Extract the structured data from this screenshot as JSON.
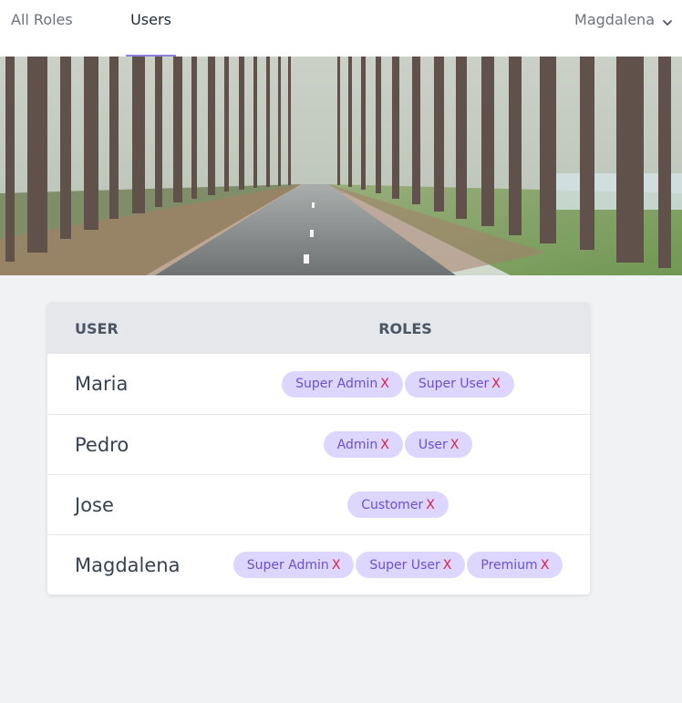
{
  "nav": {
    "tabs": [
      {
        "label": "All Roles",
        "active": false
      },
      {
        "label": "Users",
        "active": true
      }
    ],
    "current_user": "Magdalena",
    "accent_color": "#8b7fe0"
  },
  "banner": {
    "icon": "forest-road-photo"
  },
  "table": {
    "headers": {
      "user": "USER",
      "roles": "ROLES"
    },
    "remove_label": "X",
    "rows": [
      {
        "user": "Maria",
        "roles": [
          "Super Admin",
          "Super User"
        ]
      },
      {
        "user": "Pedro",
        "roles": [
          "Admin",
          "User"
        ]
      },
      {
        "user": "Jose",
        "roles": [
          "Customer"
        ]
      },
      {
        "user": "Magdalena",
        "roles": [
          "Super Admin",
          "Super User",
          "Premium"
        ]
      }
    ]
  },
  "colors": {
    "pill_bg": "#ddd6fe",
    "pill_text": "#6d4fcf",
    "remove_x": "#e11d48",
    "page_bg": "#f1f2f4"
  }
}
